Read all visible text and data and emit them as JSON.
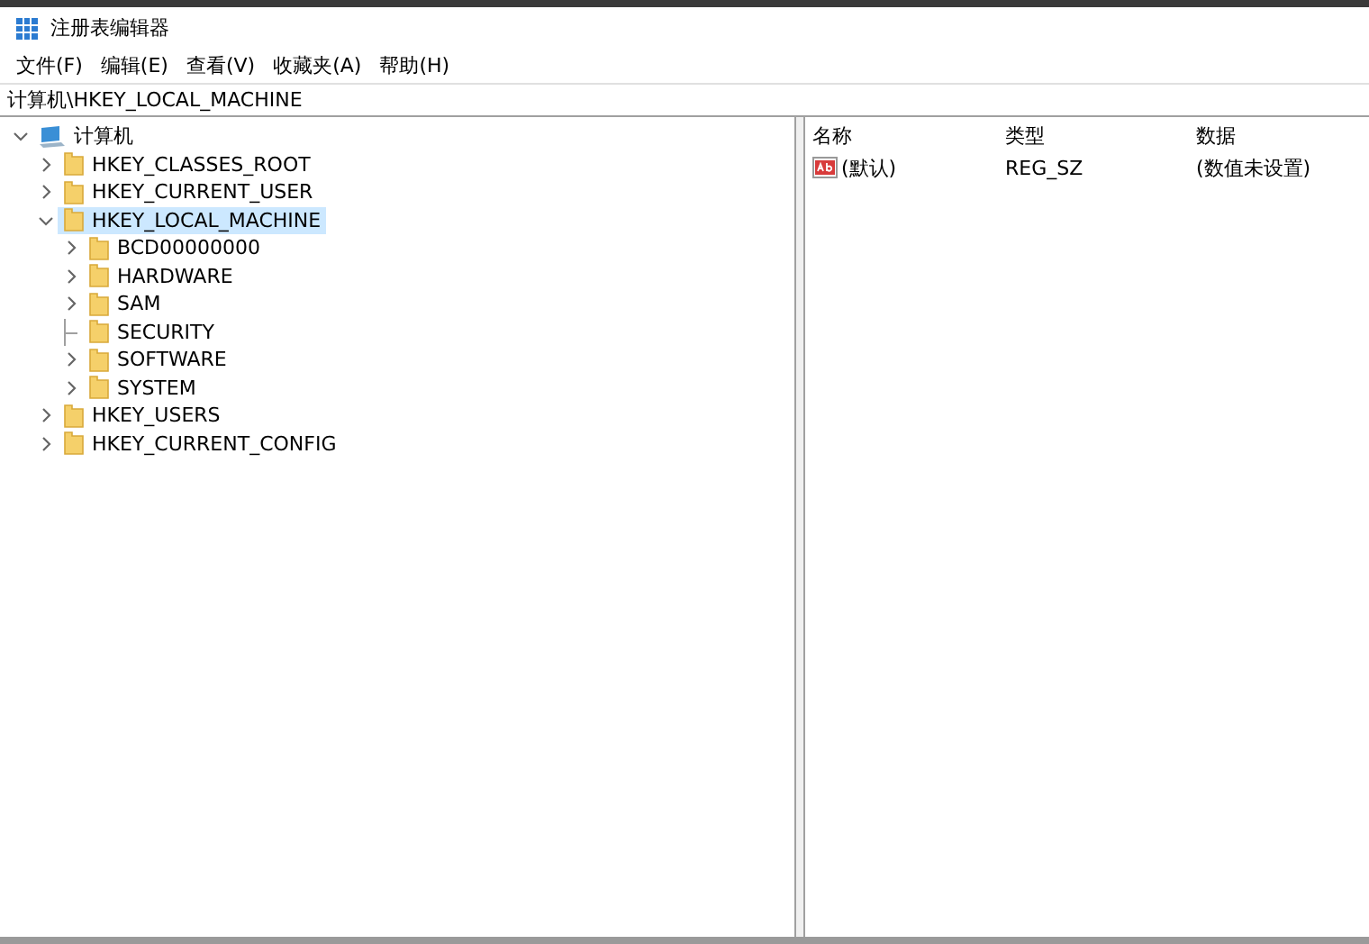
{
  "window": {
    "title": "注册表编辑器"
  },
  "menu": [
    "文件(F)",
    "编辑(E)",
    "查看(V)",
    "收藏夹(A)",
    "帮助(H)"
  ],
  "address": "计算机\\HKEY_LOCAL_MACHINE",
  "tree": [
    {
      "label": "计算机",
      "kind": "root",
      "expanded": true,
      "selected": false,
      "children": [
        {
          "label": "HKEY_CLASSES_ROOT",
          "kind": "branch",
          "expanded": false,
          "selected": false
        },
        {
          "label": "HKEY_CURRENT_USER",
          "kind": "branch",
          "expanded": false,
          "selected": false
        },
        {
          "label": "HKEY_LOCAL_MACHINE",
          "kind": "branch",
          "expanded": true,
          "selected": true,
          "children": [
            {
              "label": "BCD00000000",
              "kind": "branch",
              "expanded": false,
              "selected": false
            },
            {
              "label": "HARDWARE",
              "kind": "branch",
              "expanded": false,
              "selected": false
            },
            {
              "label": "SAM",
              "kind": "branch",
              "expanded": false,
              "selected": false
            },
            {
              "label": "SECURITY",
              "kind": "leaf",
              "selected": false
            },
            {
              "label": "SOFTWARE",
              "kind": "branch",
              "expanded": false,
              "selected": false
            },
            {
              "label": "SYSTEM",
              "kind": "branch",
              "expanded": false,
              "selected": false
            }
          ]
        },
        {
          "label": "HKEY_USERS",
          "kind": "branch",
          "expanded": false,
          "selected": false
        },
        {
          "label": "HKEY_CURRENT_CONFIG",
          "kind": "branch",
          "expanded": false,
          "selected": false
        }
      ]
    }
  ],
  "values": {
    "columns": [
      "名称",
      "类型",
      "数据"
    ],
    "rows": [
      {
        "name": "(默认)",
        "type": "REG_SZ",
        "data": "(数值未设置)",
        "selected": false
      }
    ]
  }
}
